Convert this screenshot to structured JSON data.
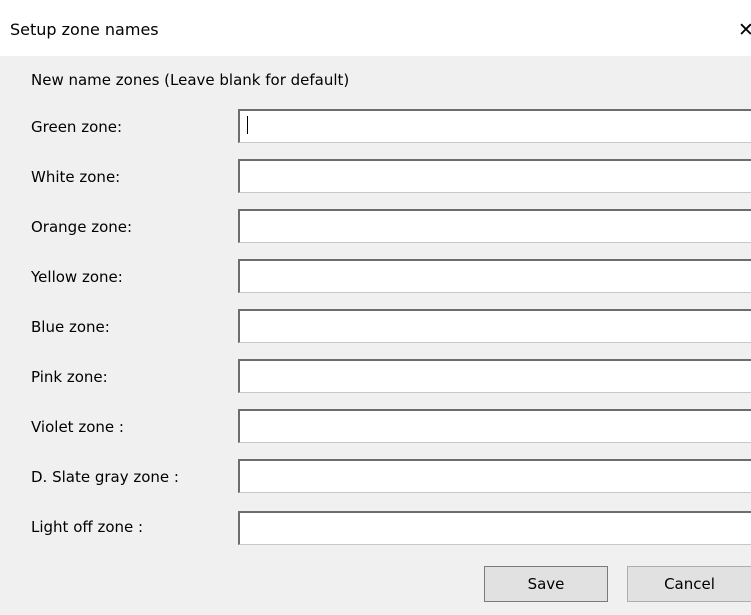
{
  "window": {
    "title": "Setup zone names",
    "close_glyph": "✕"
  },
  "form": {
    "heading": "New name zones (Leave blank for default)",
    "fields": [
      {
        "label": "Green zone:",
        "value": ""
      },
      {
        "label": "White zone:",
        "value": ""
      },
      {
        "label": "Orange zone:",
        "value": ""
      },
      {
        "label": "Yellow zone:",
        "value": ""
      },
      {
        "label": "Blue zone:",
        "value": ""
      },
      {
        "label": "Pink  zone:",
        "value": ""
      },
      {
        "label": "Violet zone :",
        "value": ""
      },
      {
        "label": "D. Slate gray zone :",
        "value": ""
      },
      {
        "label": "Light off zone :",
        "value": ""
      }
    ]
  },
  "buttons": {
    "save": "Save",
    "cancel": "Cancel"
  }
}
